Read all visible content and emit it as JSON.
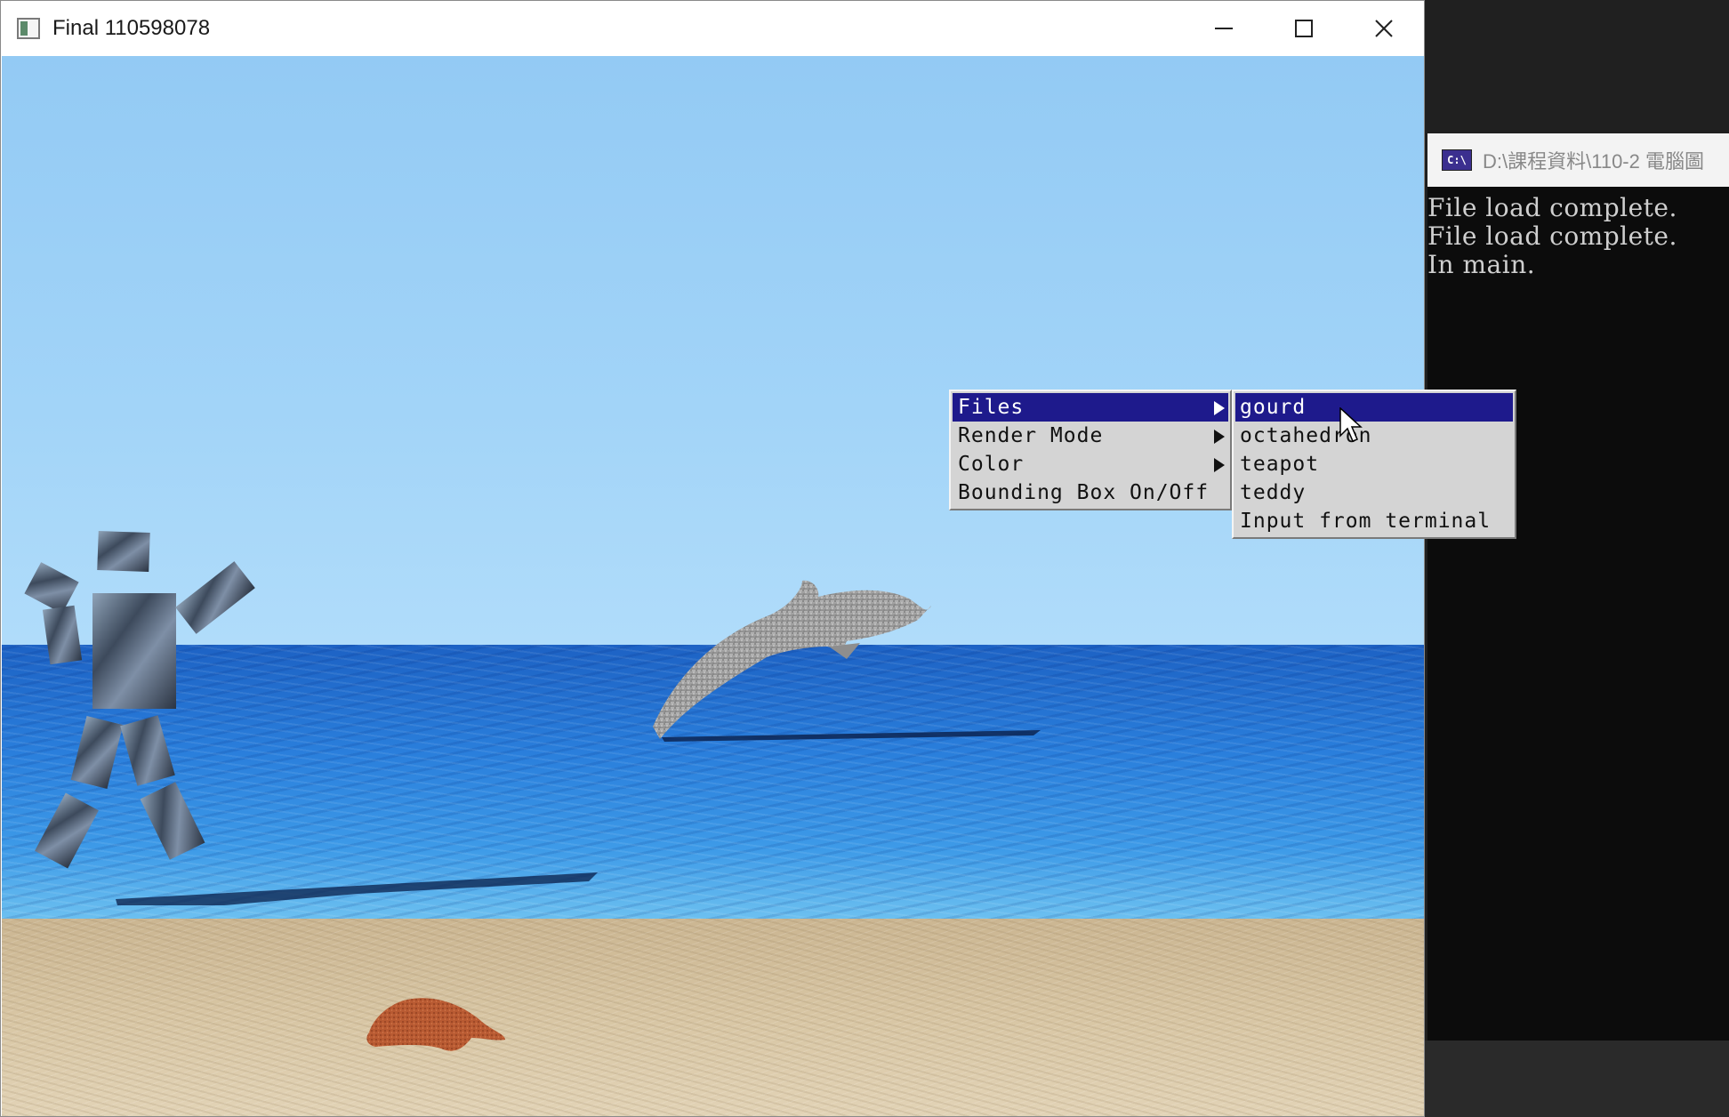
{
  "window": {
    "title": "Final 110598078",
    "controls": {
      "minimize_icon": "minimize-icon",
      "maximize_icon": "maximize-icon",
      "close_icon": "close-icon"
    }
  },
  "scene": {
    "objects": [
      "robot",
      "dolphin",
      "starfish",
      "ocean",
      "sky",
      "sand"
    ],
    "colors": {
      "sky": "#9ccff6",
      "sea": "#2a7fdc",
      "sand": "#d8c6a4"
    }
  },
  "menu": {
    "items": [
      {
        "label": "Files",
        "has_submenu": true,
        "selected": true
      },
      {
        "label": "Render Mode",
        "has_submenu": true,
        "selected": false
      },
      {
        "label": "Color",
        "has_submenu": true,
        "selected": false
      },
      {
        "label": "Bounding Box On/Off",
        "has_submenu": false,
        "selected": false
      }
    ],
    "files_submenu": [
      {
        "label": "gourd",
        "selected": true
      },
      {
        "label": "octahedron",
        "selected": false
      },
      {
        "label": "teapot",
        "selected": false
      },
      {
        "label": "teddy",
        "selected": false
      },
      {
        "label": "Input from terminal",
        "selected": false
      }
    ],
    "selected_color": "#1e1a8c"
  },
  "console": {
    "icon_text": "C:\\",
    "title": "D:\\課程資料\\110-2 電腦圖",
    "lines": [
      "File load complete.",
      "File load complete.",
      "In main."
    ]
  }
}
